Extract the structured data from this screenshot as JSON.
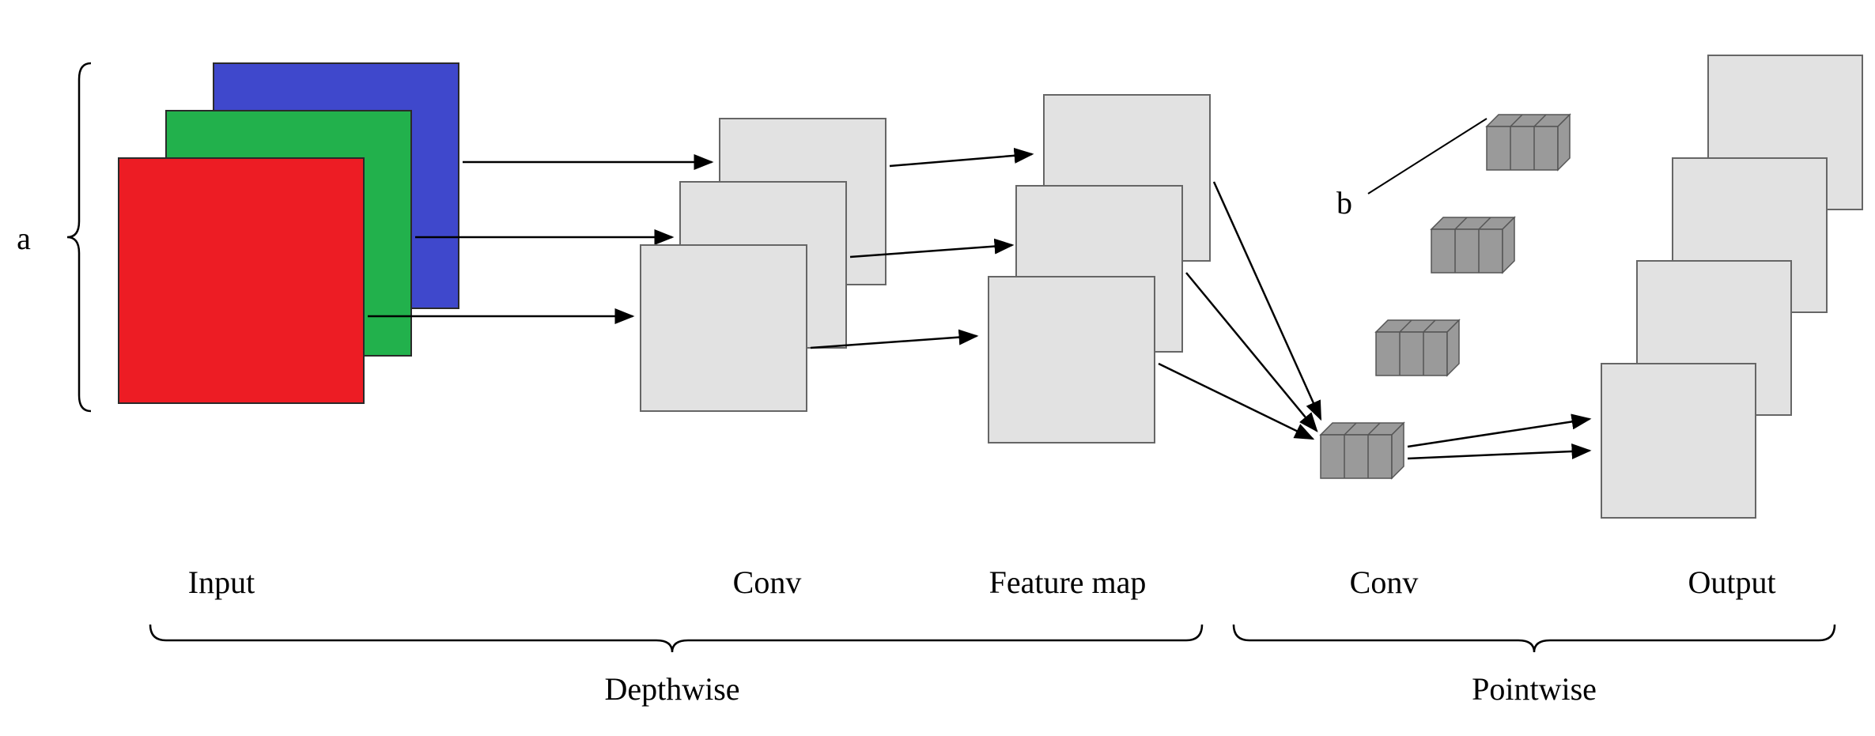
{
  "labels": {
    "a": "a",
    "b": "b",
    "input": "Input",
    "conv1": "Conv",
    "feature_map": "Feature map",
    "conv2": "Conv",
    "output": "Output",
    "depthwise": "Depthwise",
    "pointwise": "Pointwise"
  },
  "diagram": {
    "description": "Depthwise separable convolution: depthwise per-channel conv followed by pointwise 1x1 conv",
    "stages": [
      "Input",
      "Conv",
      "Feature map",
      "Conv",
      "Output"
    ],
    "sections": [
      "Depthwise",
      "Pointwise"
    ],
    "input_channels": 3,
    "pointwise_filters": 4,
    "output_channels": 4,
    "colors": {
      "red": "#ed1c24",
      "green": "#22b14c",
      "blue": "#3f48cc",
      "light_gray": "#e2e2e2",
      "dark_gray": "#9a9a9a"
    }
  }
}
